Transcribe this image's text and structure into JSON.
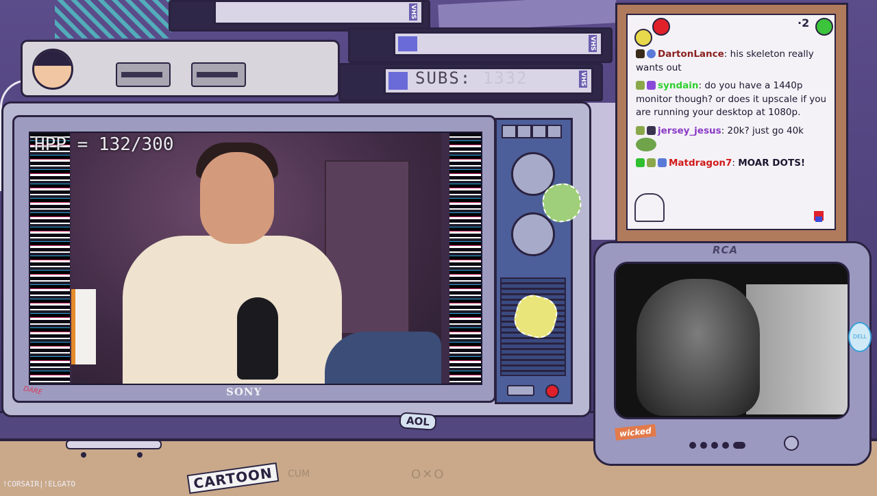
{
  "overlay": {
    "hp_counter": "HPP = 132/300",
    "subs_label": "SUBS:",
    "subs_value": "1332",
    "vhs_tag": "VHS",
    "sony_brand": "SONY",
    "rca_brand": "RCA",
    "wicked_sticker": "wicked",
    "aol_sticker": "AOL",
    "dell_sticker": "DELL",
    "cartoon_network": "CARTOON",
    "faint_text": "CUM",
    "bottom_credit": "!CORSAIR|!ELGATO",
    "dare_sticker": "DARE"
  },
  "chat": {
    "count": "2",
    "messages": [
      {
        "user": "DartonLance",
        "color": "#8a2020",
        "text": "his skeleton really wants out"
      },
      {
        "user": "syndain",
        "color": "#2fd02f",
        "text": "do you have a 1440p monitor though? or does it upscale if you are running your desktop at 1080p."
      },
      {
        "user": "jersey_jesus",
        "color": "#8a3ac7",
        "text": "20k? just go 40k"
      },
      {
        "user": "Matdragon7",
        "color": "#d11a1a",
        "text": "MOAR DOTS!"
      }
    ]
  },
  "colors": {
    "frame": "#2a2240",
    "tv_body": "#b9b8d2",
    "panel": "#4d5f9a",
    "led": "#e0212a",
    "pin_red": "#e0212a",
    "pin_yellow": "#e6d84a",
    "pin_green": "#3cc43c"
  }
}
